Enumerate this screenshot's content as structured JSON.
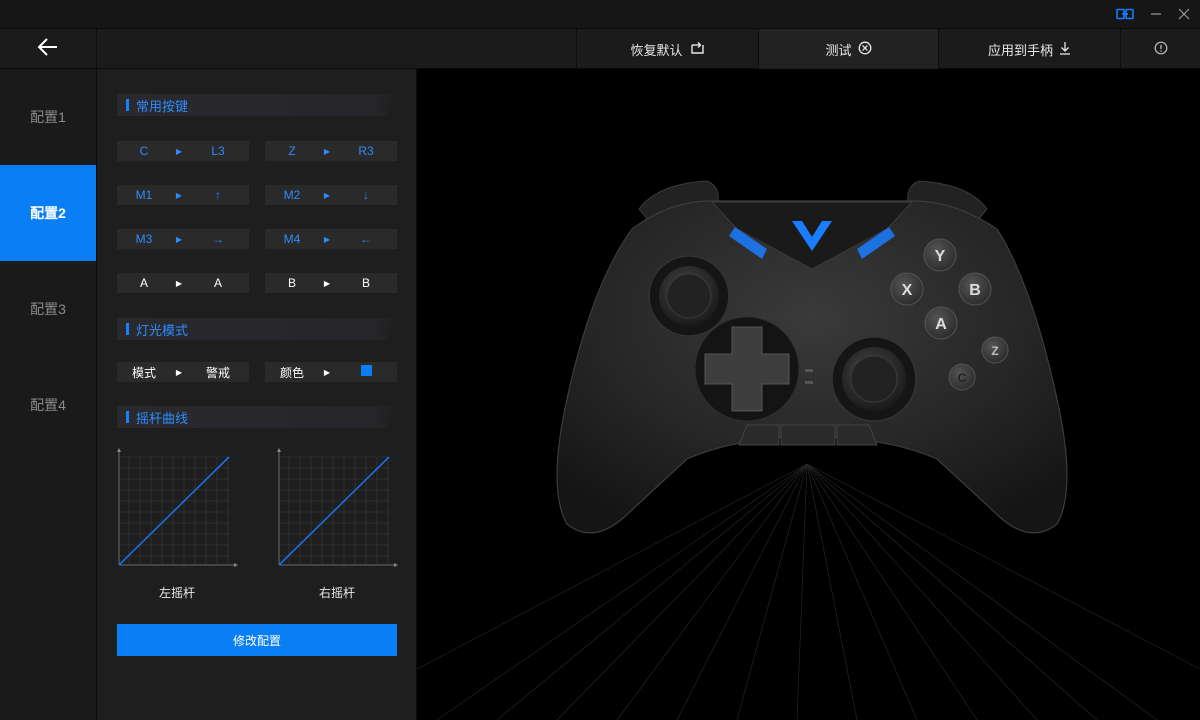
{
  "window": {
    "link_icon": "link-icon",
    "minimize_icon": "minimize-icon",
    "close_icon": "close-icon"
  },
  "topbar": {
    "back_icon": "arrow-left-icon",
    "actions": [
      {
        "label": "恢复默认",
        "icon": "restore-icon"
      },
      {
        "label": "测试",
        "icon": "test-icon"
      },
      {
        "label": "应用到手柄",
        "icon": "download-icon"
      }
    ],
    "info_icon": "info-icon"
  },
  "sidebar": {
    "items": [
      {
        "label": "配置1",
        "active": false
      },
      {
        "label": "配置2",
        "active": true
      },
      {
        "label": "配置3",
        "active": false
      },
      {
        "label": "配置4",
        "active": false
      }
    ]
  },
  "panel": {
    "common_keys": {
      "title": "常用按键",
      "rows": [
        {
          "from": "C",
          "to": "L3"
        },
        {
          "from": "Z",
          "to": "R3"
        },
        {
          "from": "M1",
          "to": "↑"
        },
        {
          "from": "M2",
          "to": "↓"
        },
        {
          "from": "M3",
          "to": "→"
        },
        {
          "from": "M4",
          "to": "←"
        },
        {
          "from": "A",
          "to": "A"
        },
        {
          "from": "B",
          "to": "B"
        }
      ]
    },
    "light_mode": {
      "title": "灯光模式",
      "mode_label": "模式",
      "mode_value": "警戒",
      "color_label": "颜色",
      "color_value": "#0a7ff5"
    },
    "stick_curve": {
      "title": "摇杆曲线",
      "left_label": "左摇杆",
      "right_label": "右摇杆"
    },
    "modify_button": "修改配置"
  },
  "controller": {
    "buttons": {
      "y": "Y",
      "x": "X",
      "b": "B",
      "a": "A",
      "z": "Z",
      "c": "C"
    },
    "accent": "#1a7dff"
  }
}
